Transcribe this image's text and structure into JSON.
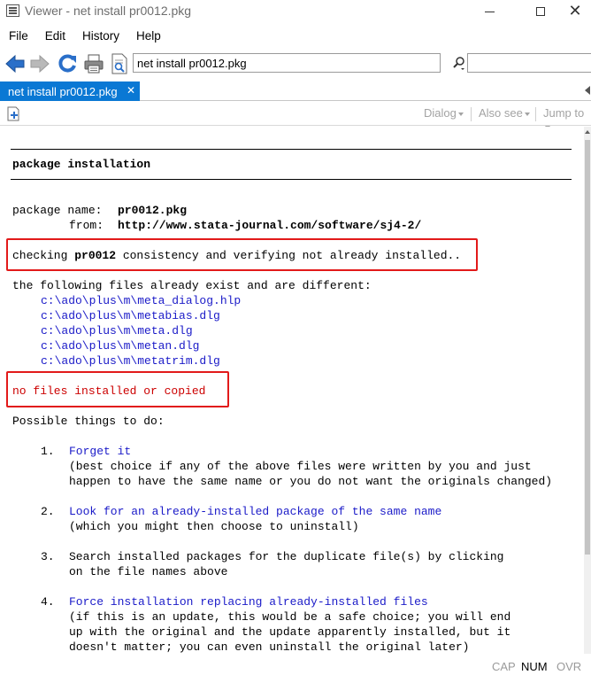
{
  "window": {
    "title": "Viewer - net install pr0012.pkg",
    "min_glyph": "",
    "close_glyph": "✕"
  },
  "menu": [
    "File",
    "Edit",
    "History",
    "Help"
  ],
  "toolbar": {
    "address_value": "net install pr0012.pkg",
    "search_value": "",
    "icons": [
      "back-arrow-icon",
      "forward-arrow-icon",
      "refresh-icon",
      "print-icon",
      "find-in-page-icon",
      "search-icon"
    ]
  },
  "tab": {
    "label": "net install pr0012.pkg",
    "close": "✕",
    "color": "#0a78d4"
  },
  "viewer_toolbar": {
    "dialog": "Dialog",
    "also_see": "Also see",
    "jump_to": "Jump to"
  },
  "content": {
    "heading": "package installation",
    "package_name_label": "package name:",
    "package_name": "pr0012.pkg",
    "from_label": "from:",
    "from_url": "http://www.stata-journal.com/software/sj4-2/",
    "checking_pre": "checking ",
    "checking_pkg": "pr0012",
    "checking_post": " consistency and verifying not already installed..",
    "exist_line": "the following files already exist and are different:",
    "files": [
      "c:\\ado\\plus\\m\\meta_dialog.hlp",
      "c:\\ado\\plus\\m\\metabias.dlg",
      "c:\\ado\\plus\\m\\meta.dlg",
      "c:\\ado\\plus\\m\\metan.dlg",
      "c:\\ado\\plus\\m\\metatrim.dlg"
    ],
    "no_files": "no files installed or copied",
    "possible": "Possible things to do:",
    "options": [
      {
        "num": "1.",
        "link": "Forget it",
        "desc": [
          "(best choice if any of the above files were written by you and just",
          "happen to have the same name or you do not want the originals changed)"
        ]
      },
      {
        "num": "2.",
        "link": "Look for an already-installed package of the same name",
        "desc": [
          "(which you might then choose to uninstall)"
        ]
      },
      {
        "num": "3.",
        "text": "Search installed packages for the duplicate file(s) by clicking",
        "desc": [
          "on the file names above"
        ]
      },
      {
        "num": "4.",
        "link": "Force installation replacing already-installed files",
        "desc": [
          "(if this is an update, this would be a safe choice; you will end",
          "up with the original and the update apparently installed, but it",
          "doesn't matter; you can even uninstall the original later)"
        ]
      }
    ]
  },
  "status": {
    "cap": "CAP",
    "num": "NUM",
    "ovr": "OVR",
    "cap_color": "#9a9a9a",
    "num_color": "#000000",
    "ovr_color": "#9a9a9a"
  }
}
